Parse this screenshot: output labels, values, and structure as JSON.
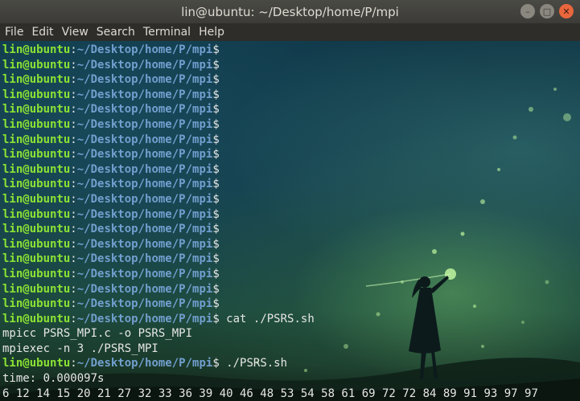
{
  "window": {
    "title": "lin@ubuntu: ~/Desktop/home/P/mpi",
    "controls": {
      "minimize": "–",
      "maximize": "□",
      "close": "✕"
    }
  },
  "menu": [
    "File",
    "Edit",
    "View",
    "Search",
    "Terminal",
    "Help"
  ],
  "prompt": {
    "user": "lin@ubuntu",
    "colon": ":",
    "path": "~/Desktop/home/P/mpi",
    "dollar": "$"
  },
  "lines": [
    {
      "type": "prompt",
      "cmd": ""
    },
    {
      "type": "prompt",
      "cmd": ""
    },
    {
      "type": "prompt",
      "cmd": ""
    },
    {
      "type": "prompt",
      "cmd": ""
    },
    {
      "type": "prompt",
      "cmd": ""
    },
    {
      "type": "prompt",
      "cmd": ""
    },
    {
      "type": "prompt",
      "cmd": ""
    },
    {
      "type": "prompt",
      "cmd": ""
    },
    {
      "type": "prompt",
      "cmd": ""
    },
    {
      "type": "prompt",
      "cmd": ""
    },
    {
      "type": "prompt",
      "cmd": ""
    },
    {
      "type": "prompt",
      "cmd": ""
    },
    {
      "type": "prompt",
      "cmd": ""
    },
    {
      "type": "prompt",
      "cmd": ""
    },
    {
      "type": "prompt",
      "cmd": ""
    },
    {
      "type": "prompt",
      "cmd": ""
    },
    {
      "type": "prompt",
      "cmd": ""
    },
    {
      "type": "prompt",
      "cmd": ""
    },
    {
      "type": "prompt",
      "cmd": " cat ./PSRS.sh"
    },
    {
      "type": "output",
      "text": "mpicc PSRS_MPI.c -o PSRS_MPI"
    },
    {
      "type": "output",
      "text": "mpiexec -n 3 ./PSRS_MPI"
    },
    {
      "type": "prompt",
      "cmd": " ./PSRS.sh"
    },
    {
      "type": "output",
      "text": "time: 0.000097s"
    },
    {
      "type": "output",
      "text": "6 12 14 15 20 21 27 32 33 36 39 40 46 48 53 54 58 61 69 72 72 84 89 91 93 97 97"
    },
    {
      "type": "prompt",
      "cmd": " ",
      "cursor": true
    }
  ],
  "colors": {
    "user": "#8ae234",
    "path": "#729fcf",
    "text": "#e6e6e6",
    "titlebar": "#3c3b37",
    "close_button": "#e9663d"
  }
}
